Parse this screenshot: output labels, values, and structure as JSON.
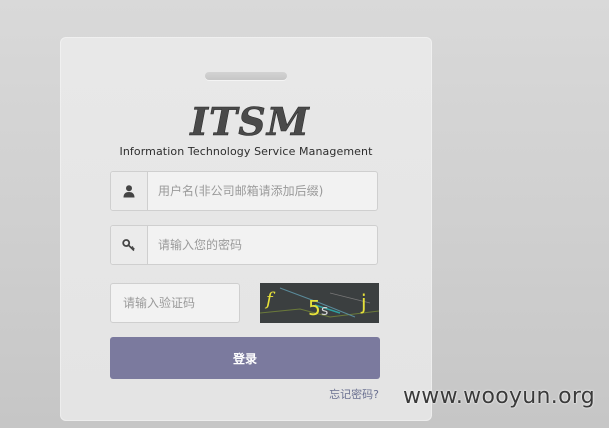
{
  "logo": {
    "text": "ITSM"
  },
  "subtitle": "Information Technology Service Management",
  "username": {
    "placeholder": "用户名(非公司邮箱请添加后缀)",
    "icon": "user-icon"
  },
  "password": {
    "placeholder": "请输入您的密码",
    "icon": "key-icon"
  },
  "captcha": {
    "placeholder": "请输入验证码",
    "image_text": "f 5s j"
  },
  "login_button": "登录",
  "forgot_password": "忘记密码?",
  "watermark": "www.wooyun.org",
  "colors": {
    "button": "#7b7a9e",
    "link": "#6a7090",
    "captcha_bg": "#3b3f40"
  }
}
